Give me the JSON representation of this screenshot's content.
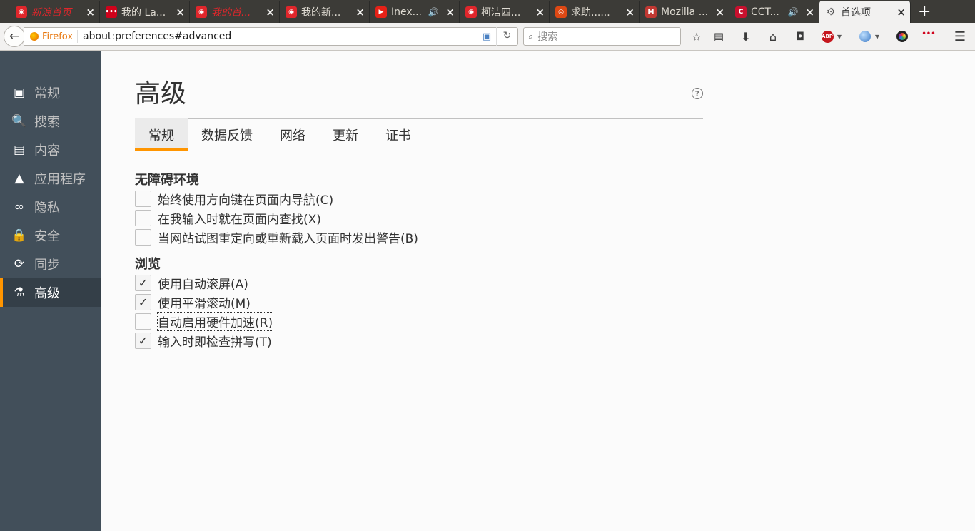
{
  "tabs": [
    {
      "label": "新浪首页",
      "icon_name": "weibo-icon",
      "icon_color": "#e0262b",
      "red_italic": true,
      "speaker": false
    },
    {
      "label": "我的 La...",
      "icon_name": "dots-app-icon",
      "icon_color": "#d0021b",
      "red_italic": false,
      "speaker": false
    },
    {
      "label": "我的首...",
      "icon_name": "weibo-icon",
      "icon_color": "#e0262b",
      "red_italic": true,
      "speaker": false
    },
    {
      "label": "我的新...",
      "icon_name": "weibo-icon",
      "icon_color": "#e0262b",
      "red_italic": false,
      "speaker": false
    },
    {
      "label": "Inex...",
      "icon_name": "youtube-icon",
      "icon_color": "#e62117",
      "red_italic": false,
      "speaker": true
    },
    {
      "label": "柯洁四...",
      "icon_name": "weibo-icon",
      "icon_color": "#e0262b",
      "red_italic": false,
      "speaker": false
    },
    {
      "label": "求助......",
      "icon_name": "ubuntu-icon",
      "icon_color": "#dd4814",
      "red_italic": false,
      "speaker": false
    },
    {
      "label": "Mozilla ...",
      "icon_name": "mozilla-dino-icon",
      "icon_color": "#c13832",
      "red_italic": false,
      "speaker": false
    },
    {
      "label": "CCT...",
      "icon_name": "cctv-icon",
      "icon_color": "#c8102e",
      "red_italic": false,
      "speaker": true
    }
  ],
  "active_tab": {
    "label": "首选项",
    "icon_name": "gear-icon"
  },
  "nav": {
    "identity_label": "Firefox",
    "url": "about:preferences#advanced",
    "search_placeholder": "搜索"
  },
  "sidebar": {
    "items": [
      {
        "label": "常规",
        "icon_name": "general-icon",
        "glyph": "▣"
      },
      {
        "label": "搜索",
        "icon_name": "search-icon",
        "glyph": "🔍"
      },
      {
        "label": "内容",
        "icon_name": "content-icon",
        "glyph": "▤"
      },
      {
        "label": "应用程序",
        "icon_name": "applications-icon",
        "glyph": "▲"
      },
      {
        "label": "隐私",
        "icon_name": "privacy-mask-icon",
        "glyph": "∞"
      },
      {
        "label": "安全",
        "icon_name": "security-lock-icon",
        "glyph": "🔒"
      },
      {
        "label": "同步",
        "icon_name": "sync-icon",
        "glyph": "⟳"
      },
      {
        "label": "高级",
        "icon_name": "advanced-wizard-hat-icon",
        "glyph": "⚗"
      }
    ],
    "selected_index": 7
  },
  "main": {
    "title": "高级",
    "tabs": [
      "常规",
      "数据反馈",
      "网络",
      "更新",
      "证书"
    ],
    "active_tab_index": 0,
    "groups": [
      {
        "title": "无障碍环境",
        "options": [
          {
            "label": "始终使用方向键在页面内导航(C)",
            "checked": false
          },
          {
            "label": "在我输入时就在页面内查找(X)",
            "checked": false
          },
          {
            "label": "当网站试图重定向或重新载入页面时发出警告(B)",
            "checked": false
          }
        ]
      },
      {
        "title": "浏览",
        "options": [
          {
            "label": "使用自动滚屏(A)",
            "checked": true
          },
          {
            "label": "使用平滑滚动(M)",
            "checked": true
          },
          {
            "label": "自动启用硬件加速(R)",
            "checked": false
          },
          {
            "label": "输入时即检查拼写(T)",
            "checked": true
          }
        ]
      }
    ]
  },
  "colors": {
    "accent": "#ff9500",
    "sidebar_bg": "#424f5a",
    "sidebar_selected": "#343f48"
  }
}
